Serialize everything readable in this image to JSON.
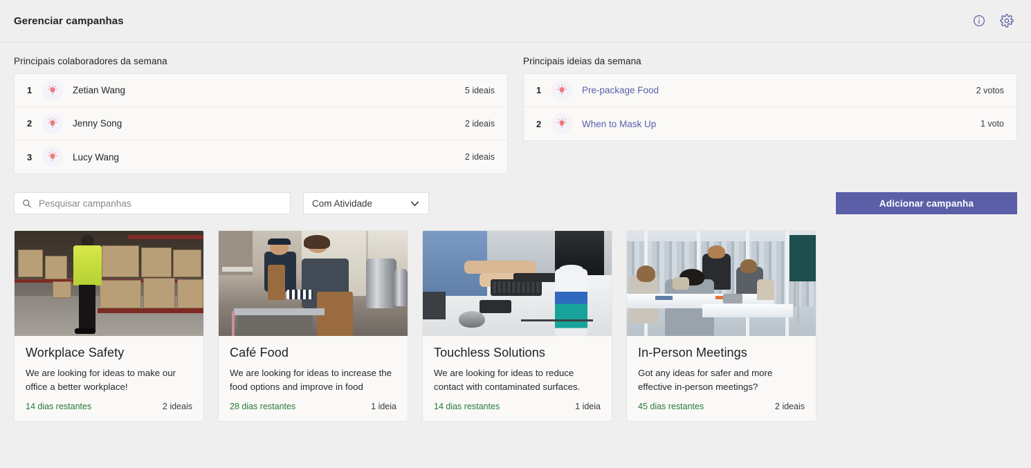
{
  "header": {
    "title": "Gerenciar campanhas",
    "info_icon": "info-icon",
    "settings_icon": "gear-icon"
  },
  "contributors_panel": {
    "title": "Principais colaboradores da semana",
    "rows": [
      {
        "rank": "1",
        "name": "Zetian Wang",
        "count": "5 ideais"
      },
      {
        "rank": "2",
        "name": "Jenny Song",
        "count": "2 ideais"
      },
      {
        "rank": "3",
        "name": "Lucy Wang",
        "count": "2 ideais"
      }
    ]
  },
  "ideas_panel": {
    "title": "Principais ideias da semana",
    "rows": [
      {
        "rank": "1",
        "name": "Pre-package Food",
        "count": "2 votos"
      },
      {
        "rank": "2",
        "name": "When to Mask Up",
        "count": "1 voto"
      }
    ]
  },
  "toolbar": {
    "search_placeholder": "Pesquisar campanhas",
    "search_value": "",
    "search_icon": "search-icon",
    "filter_value": "Com Atividade",
    "filter_options": [
      "Com Atividade"
    ],
    "chevron_icon": "chevron-down-icon",
    "add_button": "Adicionar campanha"
  },
  "campaigns": [
    {
      "title": "Workplace Safety",
      "description": "We are looking for ideas to make our office a better workplace!",
      "days": "14 dias restantes",
      "ideas": "2 ideais",
      "image_alt": "warehouse-worker-photo"
    },
    {
      "title": "Café Food",
      "description": "We are looking for ideas to increase the food options and improve in food",
      "days": "28 dias restantes",
      "ideas": "1 ideia",
      "image_alt": "cafe-workers-photo"
    },
    {
      "title": "Touchless Solutions",
      "description": "We are looking for ideas to reduce contact with contaminated surfaces.",
      "days": "14 dias restantes",
      "ideas": "1 ideia",
      "image_alt": "keyboard-cleaning-photo"
    },
    {
      "title": "In-Person Meetings",
      "description": "Got any ideas for safer and more effective in-person meetings?",
      "days": "45 dias restantes",
      "ideas": "2 ideais",
      "image_alt": "meeting-room-photo"
    }
  ],
  "colors": {
    "accent": "#5b5fa7",
    "page_bg": "#f0eff0",
    "card_bg": "#faf9f8",
    "days_green": "#267a36",
    "bulb_pink": "#ef7b80"
  }
}
